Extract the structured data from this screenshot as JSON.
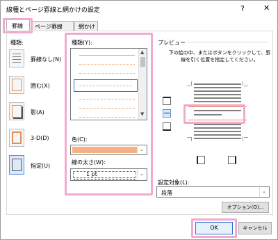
{
  "window": {
    "title": "線種とページ罫線と網かけの設定",
    "help_icon": "?",
    "close_icon": "✕"
  },
  "tabs": [
    {
      "label": "罫線"
    },
    {
      "label": "ページ罫線"
    },
    {
      "label": "網かけ"
    }
  ],
  "setting": {
    "label": "種類:",
    "items": [
      {
        "label": "罫線なし(N)"
      },
      {
        "label": "囲む(X)"
      },
      {
        "label": "影(A)"
      },
      {
        "label": "3-D(D)"
      },
      {
        "label": "指定(U)"
      }
    ]
  },
  "style": {
    "label": "種類(Y):"
  },
  "color": {
    "label": "色(C):",
    "value": "#f4b183"
  },
  "width": {
    "label": "線の太さ(W):",
    "value": "1 pt"
  },
  "preview": {
    "label": "プレビュー",
    "instructions": "下の絵の中、またはボタンをクリックして、罫線を引く位置を指定してください。"
  },
  "apply_to": {
    "label": "設定対象(L):",
    "value": "段落"
  },
  "buttons": {
    "options": "オプション(O)...",
    "ok": "OK",
    "cancel": "キャンセル"
  }
}
